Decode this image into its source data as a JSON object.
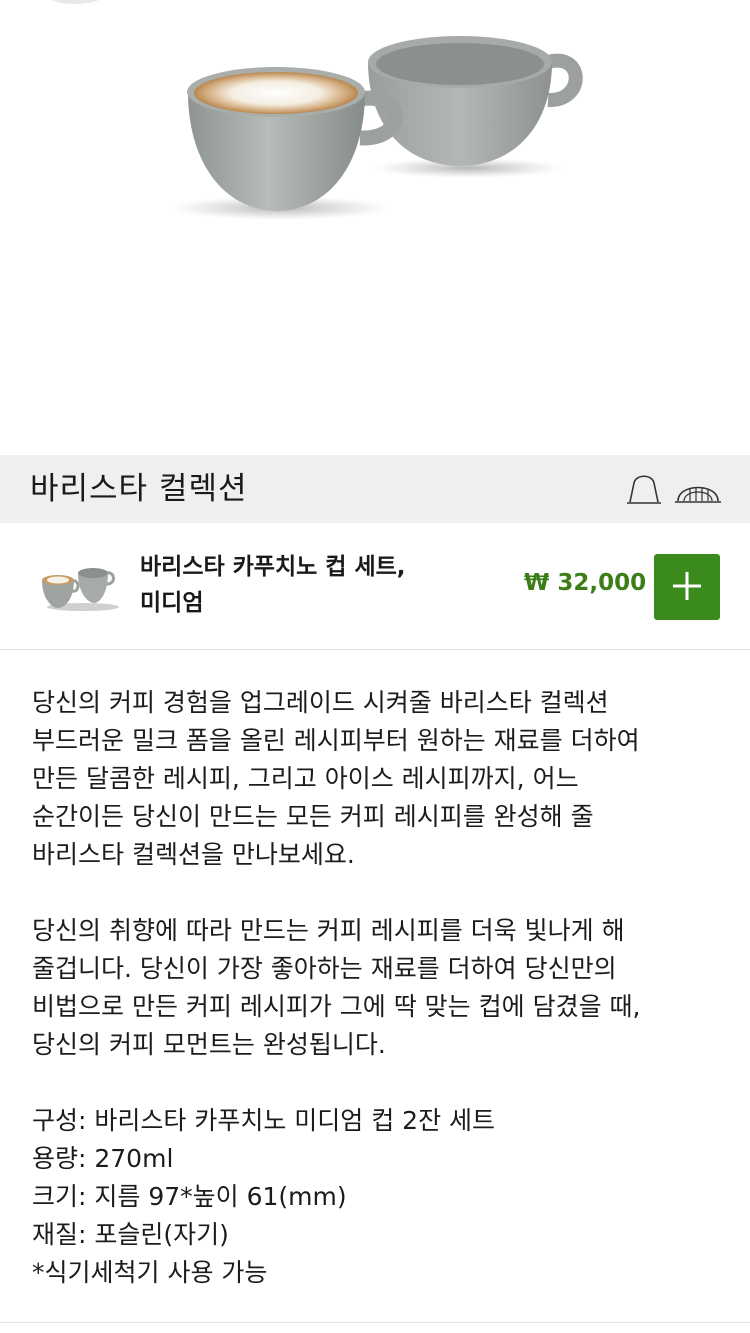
{
  "section": {
    "title": "바리스타 컬렉션",
    "icons": [
      "original-capsule-icon",
      "vertuo-capsule-icon"
    ]
  },
  "product": {
    "name_line1": "바리스타 카푸치노 컵 세트,",
    "name_line2": "미디엄",
    "price": "₩ 32,000",
    "add_icon": "plus-icon",
    "accent_color": "#3a8b1c",
    "price_color": "#3d7d18"
  },
  "description": {
    "paragraph1": [
      "당신의 커피 경험을 업그레이드 시켜줄 바리스타 컬렉션",
      "부드러운 밀크 폼을 올린 레시피부터 원하는 재료를 더하여",
      "만든 달콤한 레시피, 그리고 아이스 레시피까지, 어느",
      "순간이든 당신이 만드는 모든 커피 레시피를 완성해 줄",
      "바리스타 컬렉션을 만나보세요."
    ],
    "paragraph2": [
      "당신의 취향에 따라 만드는 커피 레시피를 더욱 빛나게 해",
      "줄겁니다. 당신이 가장 좋아하는 재료를 더하여 당신만의",
      "비법으로 만든 커피 레시피가 그에 딱 맞는 컵에 담겼을 때,",
      "당신의 커피 모먼트는 완성됩니다."
    ],
    "specs": [
      "구성: 바리스타 카푸치노 미디엄 컵 2잔 세트",
      "용량: 270ml",
      "크기: 지름 97*높이 61(mm)",
      "재질: 포슬린(자기)",
      "*식기세척기 사용 가능"
    ]
  }
}
